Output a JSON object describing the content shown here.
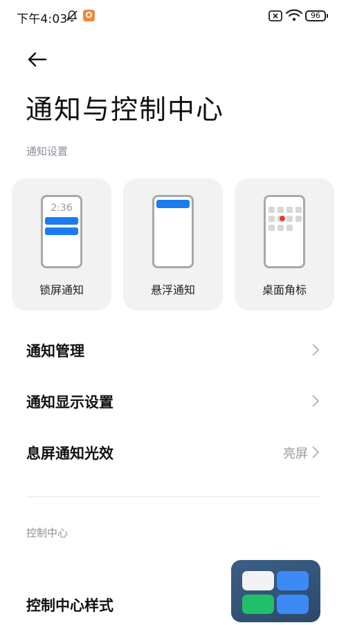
{
  "status_bar": {
    "time": "下午4:03",
    "battery": "96"
  },
  "page": {
    "title": "通知与控制中心"
  },
  "notification_section": {
    "label": "通知设置",
    "cards": [
      {
        "label": "锁屏通知",
        "clock": "2:36"
      },
      {
        "label": "悬浮通知"
      },
      {
        "label": "桌面角标"
      }
    ]
  },
  "rows": [
    {
      "label": "通知管理",
      "value": ""
    },
    {
      "label": "通知显示设置",
      "value": ""
    },
    {
      "label": "息屏通知光效",
      "value": "亮屏"
    }
  ],
  "control_section": {
    "label": "控制中心",
    "style_row": {
      "label": "控制中心样式"
    }
  },
  "colors": {
    "accent": "#1a7cf0",
    "badge": "#e53935",
    "card_bg": "#f2f2f2"
  }
}
